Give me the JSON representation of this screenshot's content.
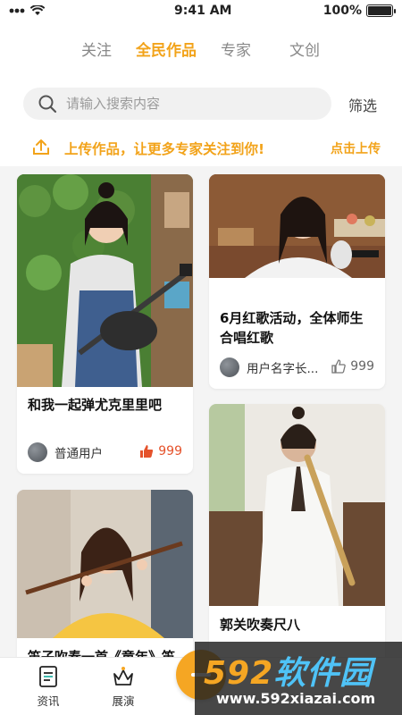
{
  "status_bar": {
    "time": "9:41 AM",
    "battery": "100%"
  },
  "tabs": [
    {
      "label": "关注",
      "active": false
    },
    {
      "label": "全民作品",
      "active": true
    },
    {
      "label": "专家",
      "active": false
    },
    {
      "label": "文创",
      "active": false
    }
  ],
  "search": {
    "placeholder": "请输入搜索内容",
    "filter_label": "筛选"
  },
  "upload_banner": {
    "text": "上传作品，让更多专家关注到你!",
    "link": "点击上传"
  },
  "cards": [
    {
      "title": "和我一起弹尤克里里吧",
      "user": "普通用户",
      "likes": "999"
    },
    {
      "title": "6月红歌活动，全体师生合唱红歌",
      "user": "用户名字长...",
      "likes": "999"
    },
    {
      "title": "笛子吹奏一首《童年》笛",
      "user": "",
      "likes": ""
    },
    {
      "title": "郭关吹奏尺八",
      "user": "",
      "likes": ""
    }
  ],
  "tabbar": [
    {
      "label": "资讯"
    },
    {
      "label": "展演"
    }
  ],
  "watermark": {
    "number": "592",
    "name": "软件园",
    "url": "www.592xiazai.com"
  },
  "colors": {
    "accent": "#f2a31a",
    "like_red": "#e5522b"
  }
}
